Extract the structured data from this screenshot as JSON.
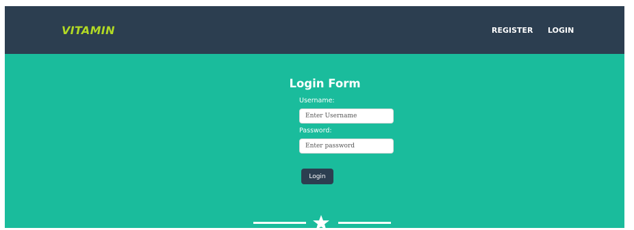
{
  "navbar": {
    "brand": "VITAMIN",
    "links": [
      {
        "label": "REGISTER"
      },
      {
        "label": "LOGIN"
      }
    ]
  },
  "login_form": {
    "title": "Login Form",
    "username_label": "Username:",
    "username_placeholder": "Enter Username",
    "password_label": "Password:",
    "password_placeholder": "Enter password",
    "submit_label": "Login"
  },
  "divider": {
    "icon": "star-icon"
  },
  "colors": {
    "navbar_bg": "#2c3e50",
    "brand": "#b2d925",
    "hero_bg": "#1abc9c",
    "button_bg": "#2c3e50"
  }
}
